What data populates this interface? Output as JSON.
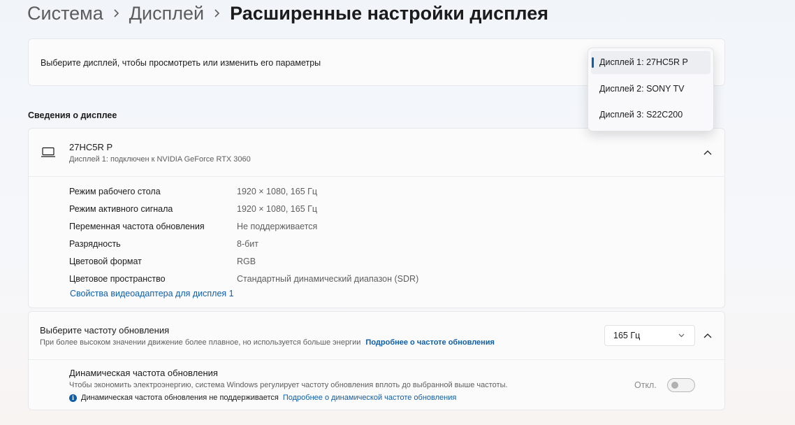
{
  "breadcrumb": {
    "items": [
      "Система",
      "Дисплей"
    ],
    "current": "Расширенные настройки дисплея"
  },
  "display_select": {
    "label": "Выберите дисплей, чтобы просмотреть или изменить его параметры",
    "options": [
      "Дисплей 1: 27HC5R P",
      "Дисплей 2: SONY TV",
      "Дисплей 3: S22C200"
    ],
    "selected_index": 0
  },
  "info_section": {
    "title": "Сведения о дисплее",
    "display_name": "27HC5R P",
    "display_desc": "Дисплей 1: подключен к NVIDIA GeForce RTX 3060",
    "properties": [
      {
        "key": "Режим рабочего стола",
        "value": "1920 × 1080, 165 Гц"
      },
      {
        "key": "Режим активного сигнала",
        "value": "1920 × 1080, 165 Гц"
      },
      {
        "key": "Переменная частота обновления",
        "value": "Не поддерживается"
      },
      {
        "key": "Разрядность",
        "value": "8-бит"
      },
      {
        "key": "Цветовой формат",
        "value": "RGB"
      },
      {
        "key": "Цветовое пространство",
        "value": "Стандартный динамический диапазон (SDR)"
      }
    ],
    "adapter_link": "Свойства видеоадаптера для дисплея 1"
  },
  "refresh": {
    "title": "Выберите частоту обновления",
    "subtitle": "При более высоком значении движение более плавное, но используется больше энергии",
    "learn_more": "Подробнее о частоте обновления",
    "value": "165 Гц"
  },
  "dynamic_refresh": {
    "title": "Динамическая частота обновления",
    "subtitle": "Чтобы экономить электроэнергию, система Windows регулирует частоту обновления вплоть до выбранной выше частоты.",
    "note": "Динамическая частота обновления не поддерживается",
    "note_link": "Подробнее о динамической частоте обновления",
    "toggle_label": "Откл.",
    "toggle_on": false
  },
  "colors": {
    "accent": "#0f5ea8"
  }
}
